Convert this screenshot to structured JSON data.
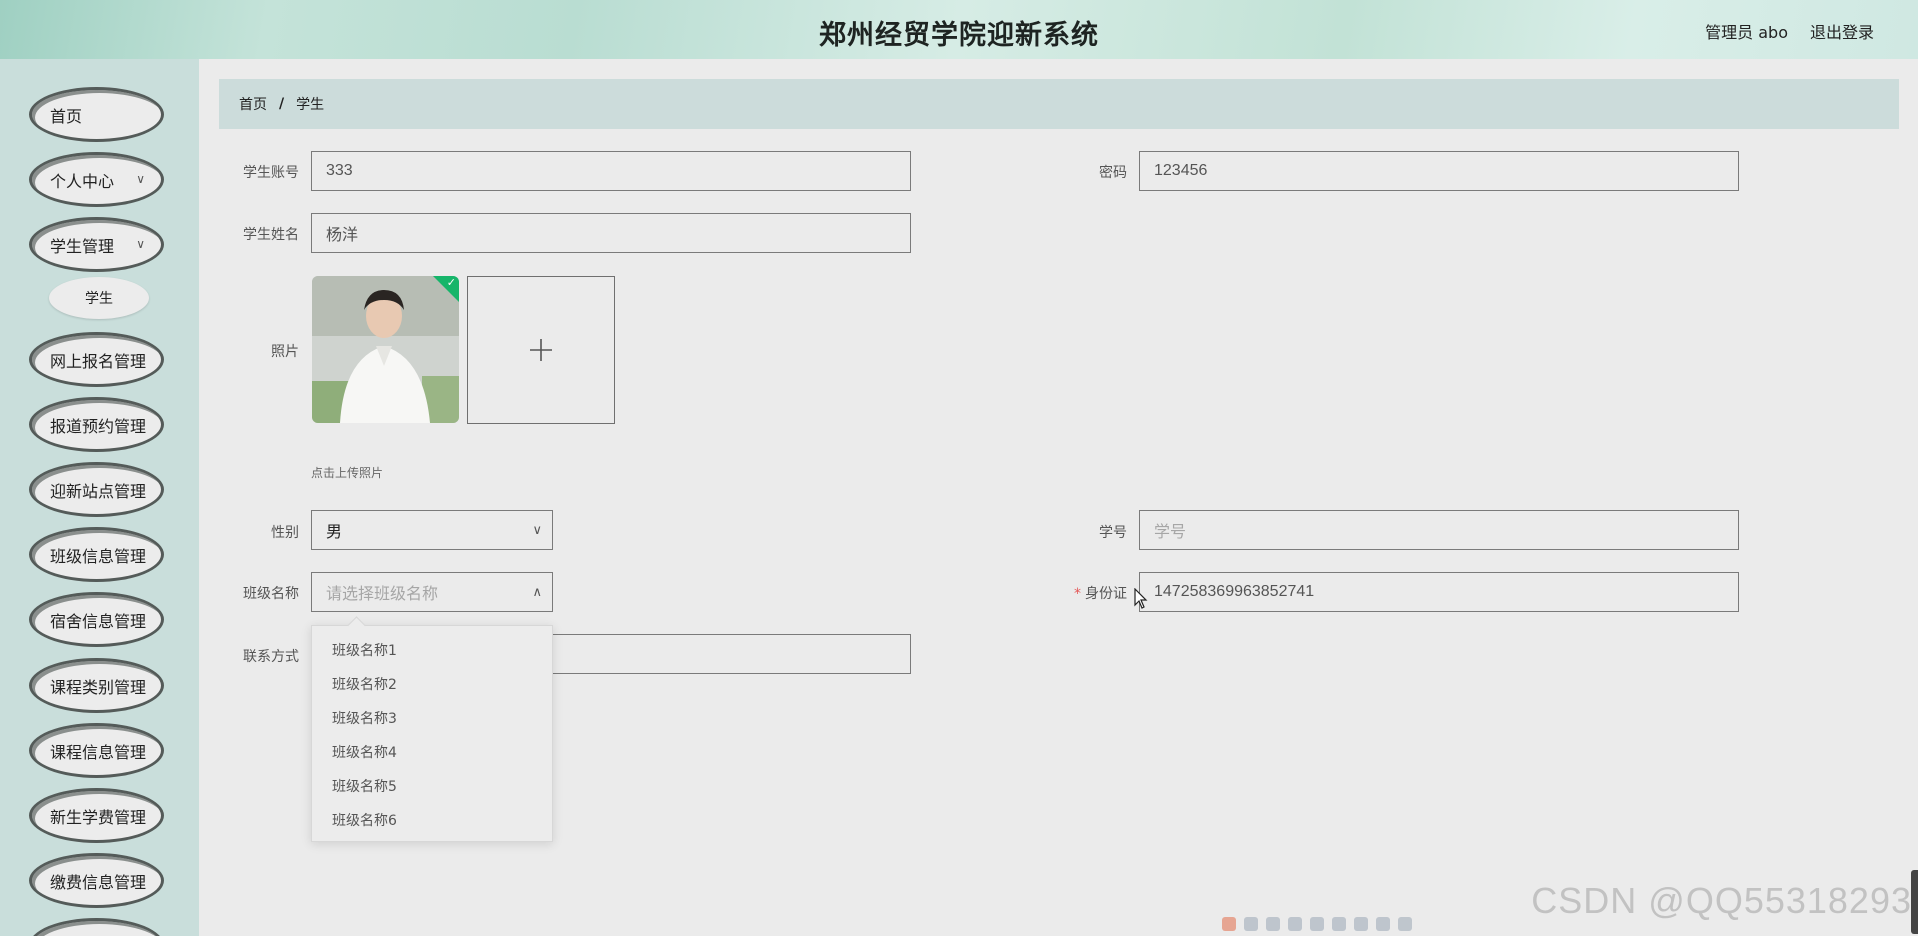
{
  "header": {
    "title": "郑州经贸学院迎新系统",
    "user": "管理员 abo",
    "logout": "退出登录"
  },
  "sidebar": {
    "items": [
      {
        "label": "首页"
      },
      {
        "label": "个人中心",
        "expandable": true
      },
      {
        "label": "学生管理",
        "expandable": true
      },
      {
        "label": "网上报名管理"
      },
      {
        "label": "报道预约管理"
      },
      {
        "label": "迎新站点管理"
      },
      {
        "label": "班级信息管理"
      },
      {
        "label": "宿舍信息管理"
      },
      {
        "label": "课程类别管理"
      },
      {
        "label": "课程信息管理"
      },
      {
        "label": "新生学费管理"
      },
      {
        "label": "缴费信息管理"
      }
    ],
    "sub_item": "学生"
  },
  "breadcrumb": {
    "home": "首页",
    "separator": "/",
    "current": "学生"
  },
  "form": {
    "account_label": "学生账号",
    "account_value": "333",
    "password_label": "密码",
    "password_value": "123456",
    "name_label": "学生姓名",
    "name_value": "杨洋",
    "photo_label": "照片",
    "upload_hint": "点击上传照片",
    "gender_label": "性别",
    "gender_value": "男",
    "student_no_label": "学号",
    "student_no_placeholder": "学号",
    "class_label": "班级名称",
    "class_placeholder": "请选择班级名称",
    "id_card_required": "*",
    "id_card_label": "身份证",
    "id_card_value": "147258369963852741",
    "contact_label": "联系方式",
    "contact_value": ""
  },
  "class_options": [
    "班级名称1",
    "班级名称2",
    "班级名称3",
    "班级名称4",
    "班级名称5",
    "班级名称6"
  ],
  "watermark": "CSDN @QQ55318293",
  "icons": {
    "chevron": "chevron-down-icon",
    "upload": "plus-icon",
    "check": "check-icon"
  },
  "colors": {
    "sidebar_bg": "#c9dedb",
    "breadcrumb_bg": "#ccdcdb",
    "pill_border": "#545b59",
    "success": "#16b56a",
    "required": "#e45656"
  }
}
